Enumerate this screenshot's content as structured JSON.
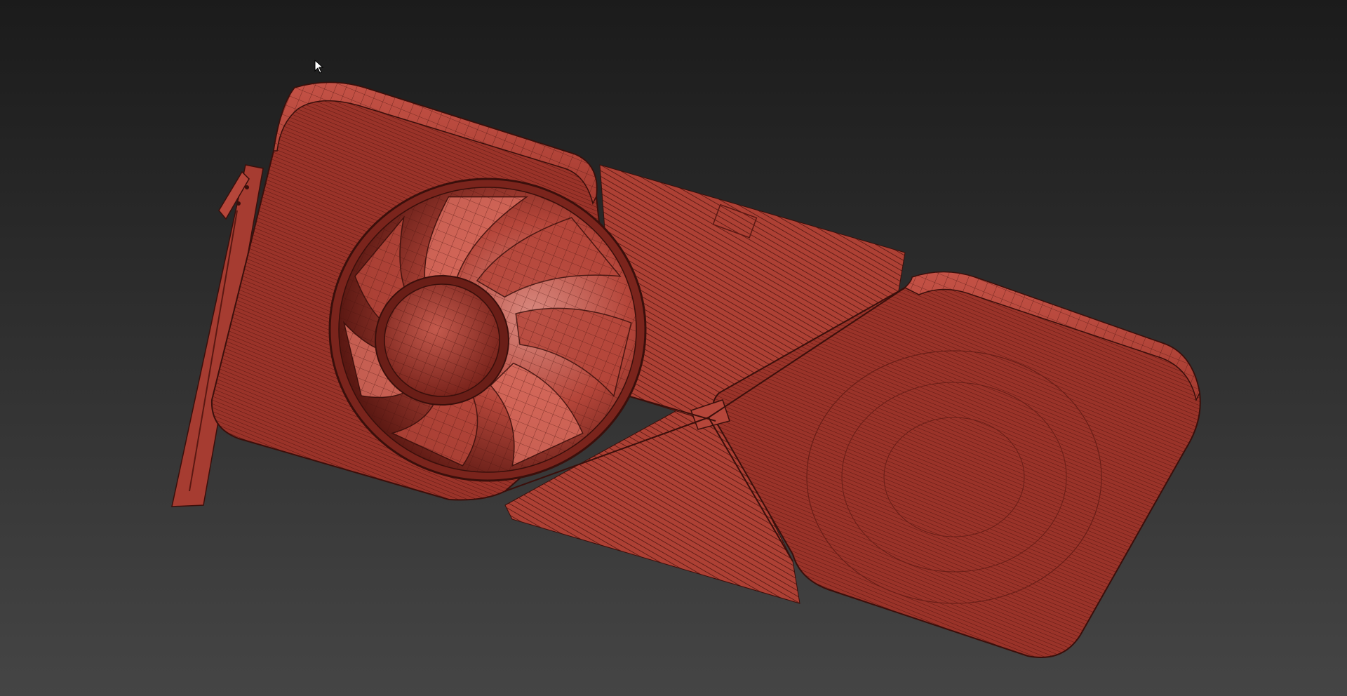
{
  "viewport": {
    "background_top": "#1b1b1b",
    "background_bottom": "#454545"
  },
  "model": {
    "name": "graphics-card",
    "display_mode": "shaded-wireframe",
    "base_color": "#b5463a",
    "dark_color": "#7a241c",
    "light_color": "#d66a5c",
    "edge_color": "#3a0f0b",
    "fan_blade_count": 7
  },
  "cursor": {
    "icon": "arrow-pointer-icon"
  }
}
